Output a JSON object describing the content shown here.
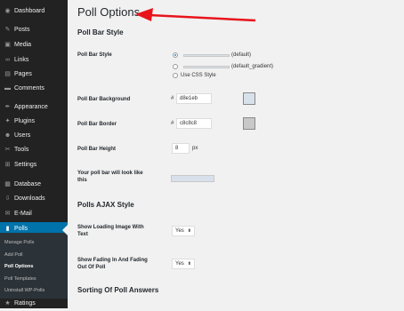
{
  "sidebar": {
    "items": [
      {
        "label": "Dashboard",
        "icon": "dashboard-icon",
        "glyph": "◉"
      },
      {
        "label": "Posts",
        "icon": "pin-icon",
        "glyph": "✎"
      },
      {
        "label": "Media",
        "icon": "media-icon",
        "glyph": "▣"
      },
      {
        "label": "Links",
        "icon": "link-icon",
        "glyph": "∞"
      },
      {
        "label": "Pages",
        "icon": "page-icon",
        "glyph": "▤"
      },
      {
        "label": "Comments",
        "icon": "comment-icon",
        "glyph": "▬"
      },
      {
        "label": "Appearance",
        "icon": "brush-icon",
        "glyph": "✒"
      },
      {
        "label": "Plugins",
        "icon": "plugin-icon",
        "glyph": "✦"
      },
      {
        "label": "Users",
        "icon": "user-icon",
        "glyph": "☻"
      },
      {
        "label": "Tools",
        "icon": "wrench-icon",
        "glyph": "✂"
      },
      {
        "label": "Settings",
        "icon": "settings-icon",
        "glyph": "⊞"
      },
      {
        "label": "Database",
        "icon": "database-icon",
        "glyph": "▦"
      },
      {
        "label": "Downloads",
        "icon": "download-icon",
        "glyph": "⇩"
      },
      {
        "label": "E-Mail",
        "icon": "email-icon",
        "glyph": "✉"
      },
      {
        "label": "Polls",
        "icon": "chart-icon",
        "glyph": "▮"
      },
      {
        "label": "Ratings",
        "icon": "star-icon",
        "glyph": "★"
      }
    ],
    "submenu": [
      "Manage Polls",
      "Add Poll",
      "Poll Options",
      "Poll Templates",
      "Uninstall WP-Polls"
    ]
  },
  "page": {
    "title": "Poll Options",
    "section_bar_style": "Poll Bar Style",
    "poll_bar_style_label": "Poll Bar Style",
    "options": [
      "(default)",
      "(default_gradient)",
      "Use CSS Style"
    ],
    "bg_label": "Poll Bar Background",
    "bg_hash": "#",
    "bg_value": "d8e1eb",
    "border_label": "Poll Bar Border",
    "border_hash": "#",
    "border_value": "c8c8c8",
    "height_label": "Poll Bar Height",
    "height_value": "8",
    "height_unit": "px",
    "preview_label": "Your poll bar will look like this",
    "section_ajax": "Polls AJAX Style",
    "loading_label": "Show Loading Image With Text",
    "loading_value": "Yes",
    "fading_label": "Show Fading In And Fading Out Of Poll",
    "fading_value": "Yes",
    "section_sorting": "Sorting Of Poll Answers"
  },
  "colors": {
    "sidebar_bg": "#222222",
    "active": "#0073aa",
    "bar_background": "#d8e1eb",
    "bar_border": "#c8c8c8",
    "arrow": "#e8141b"
  }
}
